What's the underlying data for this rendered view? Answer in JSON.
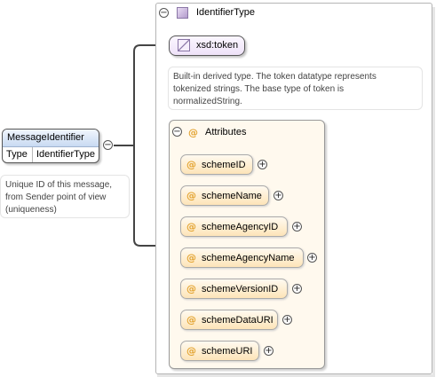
{
  "element": {
    "name": "MessageIdentifier",
    "type_key": "Type",
    "type_value": "IdentifierType",
    "doc": [
      "Unique ID of this message,",
      "from Sender point of view",
      "(uniqueness)"
    ]
  },
  "type": {
    "name": "IdentifierType",
    "base": "xsd:token",
    "doc": [
      "Built-in derived type. The token datatype represents",
      "tokenized strings. The base type of token is",
      "normalizedString."
    ]
  },
  "attributes": {
    "title": "Attributes",
    "symbol": "@",
    "items": [
      {
        "name": "schemeID"
      },
      {
        "name": "schemeName"
      },
      {
        "name": "schemeAgencyID"
      },
      {
        "name": "schemeAgencyName"
      },
      {
        "name": "schemeVersionID"
      },
      {
        "name": "schemeDataURI"
      },
      {
        "name": "schemeURI"
      }
    ]
  },
  "glyphs": {
    "collapse": "−",
    "expand": "+"
  },
  "icons": {
    "type_icon": "complex-type-icon",
    "token_icon": "simple-type-icon"
  },
  "colors": {
    "accent_attr": "#e3a330",
    "element_header": "#c8daf2",
    "type_icon": "#b39ccc"
  }
}
